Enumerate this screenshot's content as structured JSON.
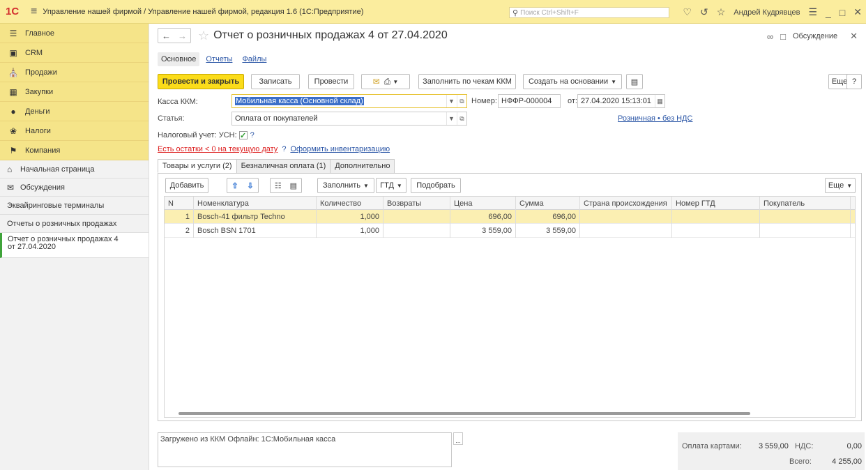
{
  "app": {
    "logo": "1С",
    "title": "Управление нашей фирмой / Управление нашей фирмой, редакция 1.6  (1С:Предприятие)",
    "search_placeholder": "Поиск Ctrl+Shift+F",
    "user": "Андрей Кудрявцев"
  },
  "sections": [
    {
      "label": "Главное",
      "icon": "menu-icon"
    },
    {
      "label": "CRM",
      "icon": "contacts-icon"
    },
    {
      "label": "Продажи",
      "icon": "shop-icon"
    },
    {
      "label": "Закупки",
      "icon": "cart-icon"
    },
    {
      "label": "Деньги",
      "icon": "money-icon"
    },
    {
      "label": "Налоги",
      "icon": "tax-icon"
    },
    {
      "label": "Компания",
      "icon": "flag-icon"
    }
  ],
  "nav": {
    "home": "Начальная страница",
    "discussions": "Обсуждения",
    "acquiring": "Эквайринговые терминалы",
    "retail_reports": "Отчеты о розничных продажах",
    "current_doc": "Отчет о розничных продажах 4 от 27.04.2020"
  },
  "doc": {
    "title": "Отчет о розничных продажах 4 от 27.04.2020",
    "discussion": "Обсуждение",
    "tabs": [
      "Основное",
      "Отчеты",
      "Файлы"
    ]
  },
  "toolbar": {
    "post_close": "Провести и закрыть",
    "save": "Записать",
    "post": "Провести",
    "fill_by_receipts": "Заполнить по чекам ККМ",
    "create_based": "Создать на основании",
    "more": "Еще",
    "help": "?"
  },
  "form": {
    "kkm_label": "Касса ККМ:",
    "kkm_value": "Мобильная касса (Основной склад)",
    "number_label": "Номер:",
    "number_value": "НФФР-000004",
    "date_label": "от:",
    "date_value": "27.04.2020 15:13:01",
    "article_label": "Статья:",
    "article_value": "Оплата от покупателей",
    "vat_link": "Розничная • без НДС",
    "tax_label": "Налоговый учет: УСН:",
    "tax_help": "?",
    "warning_link": "Есть остатки < 0 на текущую дату",
    "warning_help": "?",
    "inventory_link": "Оформить инвентаризацию"
  },
  "page_tabs": [
    "Товары и услуги (2)",
    "Безналичная оплата (1)",
    "Дополнительно"
  ],
  "table_toolbar": {
    "add": "Добавить",
    "fill": "Заполнить",
    "gtd": "ГТД",
    "pick": "Подобрать",
    "more": "Еще"
  },
  "table": {
    "columns": [
      "N",
      "Номенклатура",
      "Количество",
      "Возвраты",
      "Цена",
      "Сумма",
      "Страна происхождения",
      "Номер ГТД",
      "Покупатель"
    ],
    "rows": [
      {
        "n": "1",
        "item": "Bosch-41 фильтр Techno",
        "qty": "1,000",
        "returns": "",
        "price": "696,00",
        "sum": "696,00",
        "country": "",
        "gtd": "",
        "buyer": ""
      },
      {
        "n": "2",
        "item": "Bosch BSN 1701",
        "qty": "1,000",
        "returns": "",
        "price": "3 559,00",
        "sum": "3 559,00",
        "country": "",
        "gtd": "",
        "buyer": ""
      }
    ]
  },
  "comment": "Загружено из ККМ Офлайн: 1С:Мобильная касса",
  "totals": {
    "card_label": "Оплата картами:",
    "card_value": "3 559,00",
    "vat_label": "НДС:",
    "vat_value": "0,00",
    "total_label": "Всего:",
    "total_value": "4 255,00"
  },
  "colors": {
    "title_bar": "#fbed9e",
    "section_bg": "#f5e489",
    "primary_button": "#fbdc1a",
    "link": "#2a55a6",
    "selected_row": "#fbefb2",
    "active_nav": "#3fa33a"
  }
}
